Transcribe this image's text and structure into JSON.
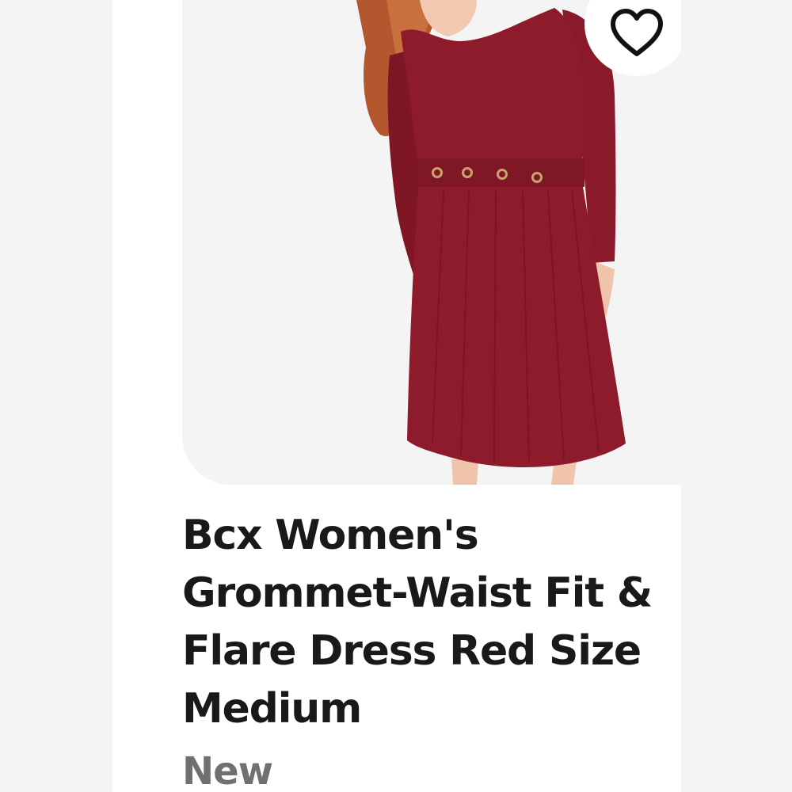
{
  "listing": {
    "image": {
      "subject": "model-in-red-dress",
      "dress_color": "#8e1b2c"
    },
    "favorite": {
      "icon": "heart-icon"
    },
    "title_lines": [
      "Bcx Women's",
      "Grommet-Waist Fit &",
      "Flare Dress Red Size",
      "Medium"
    ],
    "condition": "New"
  }
}
